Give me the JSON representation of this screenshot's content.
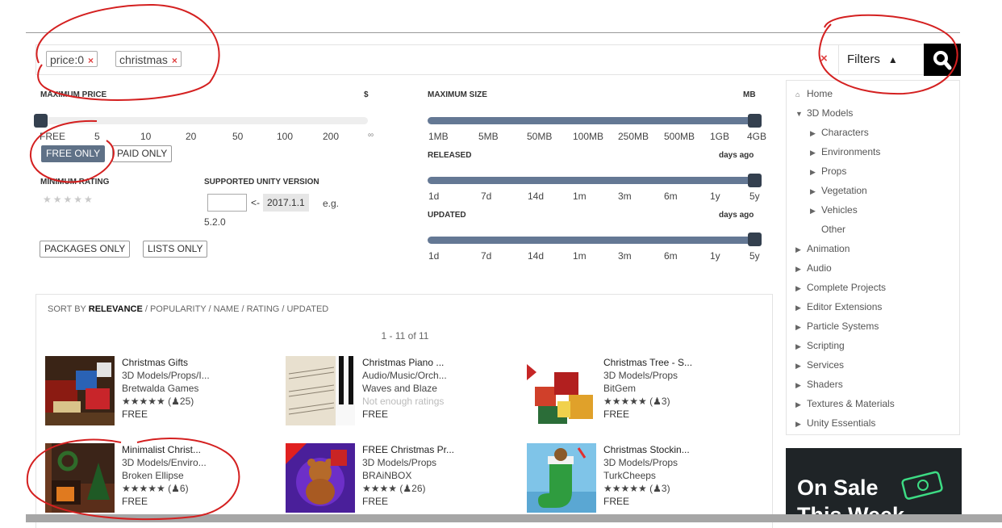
{
  "search": {
    "tags": [
      {
        "label": "price:0",
        "remove": "×"
      },
      {
        "label": "christmas",
        "remove": "×"
      }
    ],
    "clear": "×",
    "filters_label": "Filters",
    "filters_arrow": "▲"
  },
  "filters": {
    "max_price": {
      "label": "MAXIMUM PRICE",
      "unit": "$",
      "ticks": [
        "FREE",
        "5",
        "10",
        "20",
        "50",
        "100",
        "200",
        "∞"
      ],
      "level": 0,
      "free_only": "FREE ONLY",
      "paid_only": "PAID ONLY"
    },
    "min_rating": {
      "label": "MINIMUM RATING",
      "stars": "★★★★★"
    },
    "unity_version": {
      "label": "SUPPORTED UNITY VERSION",
      "arrow": "<-",
      "version": "2017.1.1",
      "eg": "e.g.",
      "eg_value": "5.2.0"
    },
    "packages_only": "PACKAGES ONLY",
    "lists_only": "LISTS ONLY",
    "max_size": {
      "label": "MAXIMUM SIZE",
      "unit": "MB",
      "ticks": [
        "1MB",
        "5MB",
        "50MB",
        "100MB",
        "250MB",
        "500MB",
        "1GB",
        "4GB"
      ],
      "level": 1
    },
    "released": {
      "label": "RELEASED",
      "unit": "days ago",
      "ticks": [
        "1d",
        "7d",
        "14d",
        "1m",
        "3m",
        "6m",
        "1y",
        "5y"
      ],
      "level": 1
    },
    "updated": {
      "label": "UPDATED",
      "unit": "days ago",
      "ticks": [
        "1d",
        "7d",
        "14d",
        "1m",
        "3m",
        "6m",
        "1y",
        "5y"
      ],
      "level": 1
    }
  },
  "results": {
    "sort_prefix": "SORT BY",
    "sort_active": "RELEVANCE",
    "sort_rest": "/ POPULARITY / NAME / RATING / UPDATED",
    "range": "1 - 11 of 11",
    "items": [
      {
        "title": "Christmas Gifts",
        "category": "3D Models/Props/I...",
        "publisher": "Bretwalda Games",
        "stars": "★★★★★",
        "count": "25",
        "rating_text": "",
        "price": "FREE"
      },
      {
        "title": "Christmas Piano ...",
        "category": "Audio/Music/Orch...",
        "publisher": "Waves and Blaze",
        "stars": "",
        "count": "",
        "rating_text": "Not enough ratings",
        "price": "FREE"
      },
      {
        "title": "Christmas Tree - S...",
        "category": "3D Models/Props",
        "publisher": "BitGem",
        "stars": "★★★★★",
        "count": "3",
        "rating_text": "",
        "price": "FREE"
      },
      {
        "title": "Minimalist Christ...",
        "category": "3D Models/Enviro...",
        "publisher": "Broken Ellipse",
        "stars": "★★★★★",
        "count": "6",
        "rating_text": "",
        "price": "FREE"
      },
      {
        "title": "FREE Christmas Pr...",
        "category": "3D Models/Props",
        "publisher": "BRAiNBOX",
        "stars": "★★★★",
        "count": "26",
        "rating_text": "",
        "price": "FREE"
      },
      {
        "title": "Christmas Stockin...",
        "category": "3D Models/Props",
        "publisher": "TurkCheeps",
        "stars": "★★★★★",
        "count": "3",
        "rating_text": "",
        "price": "FREE"
      }
    ]
  },
  "sidebar": {
    "items": [
      {
        "icon": "home-icon",
        "label": "Home"
      },
      {
        "icon": "caret-down-icon",
        "label": "3D Models"
      },
      {
        "icon": "caret-right-icon",
        "label": "Characters"
      },
      {
        "icon": "caret-right-icon",
        "label": "Environments"
      },
      {
        "icon": "caret-right-icon",
        "label": "Props"
      },
      {
        "icon": "caret-right-icon",
        "label": "Vegetation"
      },
      {
        "icon": "caret-right-icon",
        "label": "Vehicles"
      },
      {
        "icon": "",
        "label": "Other"
      },
      {
        "icon": "caret-right-icon",
        "label": "Animation"
      },
      {
        "icon": "caret-right-icon",
        "label": "Audio"
      },
      {
        "icon": "caret-right-icon",
        "label": "Complete Projects"
      },
      {
        "icon": "caret-right-icon",
        "label": "Editor Extensions"
      },
      {
        "icon": "caret-right-icon",
        "label": "Particle Systems"
      },
      {
        "icon": "caret-right-icon",
        "label": "Scripting"
      },
      {
        "icon": "caret-right-icon",
        "label": "Services"
      },
      {
        "icon": "caret-right-icon",
        "label": "Shaders"
      },
      {
        "icon": "caret-right-icon",
        "label": "Textures & Materials"
      },
      {
        "icon": "caret-right-icon",
        "label": "Unity Essentials"
      }
    ]
  },
  "promo": {
    "line1": "On Sale",
    "line2": "This Week"
  },
  "colors": {
    "accent": "#5f7187",
    "annotation": "#d42020",
    "search_button": "#000000"
  }
}
